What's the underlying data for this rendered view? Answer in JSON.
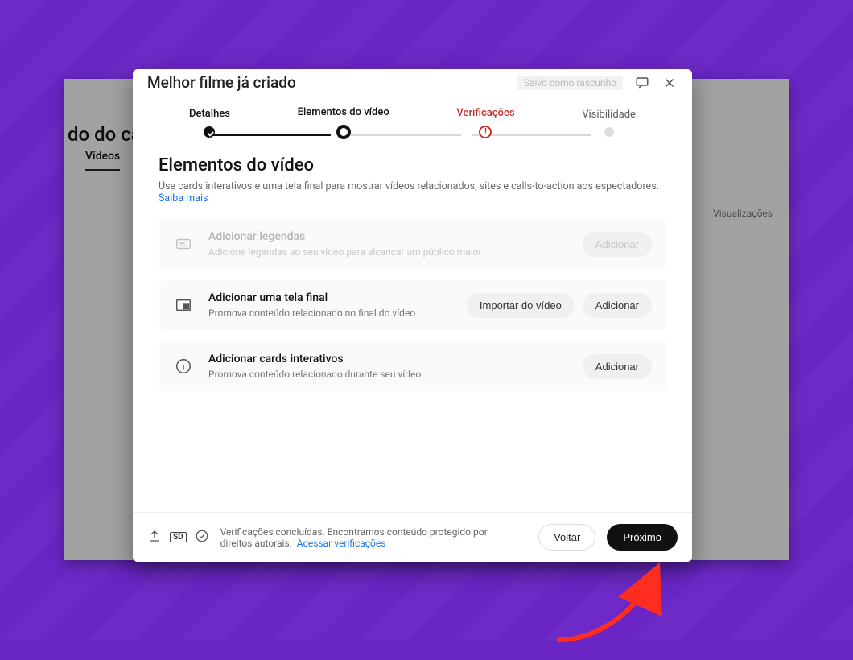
{
  "background": {
    "studio_header": "do do canal",
    "tabs": {
      "active": "Vídeos"
    },
    "columns": {
      "views": "Visualizações"
    }
  },
  "dialog": {
    "title": "Melhor filme já criado",
    "header_actions": {
      "draft_chip": "Salvo como rascunho"
    }
  },
  "stepper": {
    "steps": [
      {
        "label": "Detalhes",
        "state": "done"
      },
      {
        "label": "Elementos do vídeo",
        "state": "current"
      },
      {
        "label": "Verificações",
        "state": "error"
      },
      {
        "label": "Visibilidade",
        "state": "future"
      }
    ]
  },
  "section": {
    "title": "Elementos do vídeo",
    "subtitle": "Use cards interativos e uma tela final para mostrar vídeos relacionados, sites e calls-to-action aos espectadores. ",
    "learn_more": "Saiba mais"
  },
  "options": {
    "subtitles": {
      "title": "Adicionar legendas",
      "desc": "Adicione legendas ao seu vídeo para alcançar um público maior",
      "add": "Adicionar"
    },
    "endscreen": {
      "title": "Adicionar uma tela final",
      "desc": "Promova conteúdo relacionado no final do vídeo",
      "import": "Importar do vídeo",
      "add": "Adicionar"
    },
    "cards": {
      "title": "Adicionar cards interativos",
      "desc": "Promova conteúdo relacionado durante seu vídeo",
      "add": "Adicionar"
    }
  },
  "footer": {
    "sd": "SD",
    "status": "Verificações concluídas. Encontramos conteúdo protegido por direitos autorais.",
    "link": "Acessar verificações",
    "back": "Voltar",
    "next": "Próximo"
  }
}
